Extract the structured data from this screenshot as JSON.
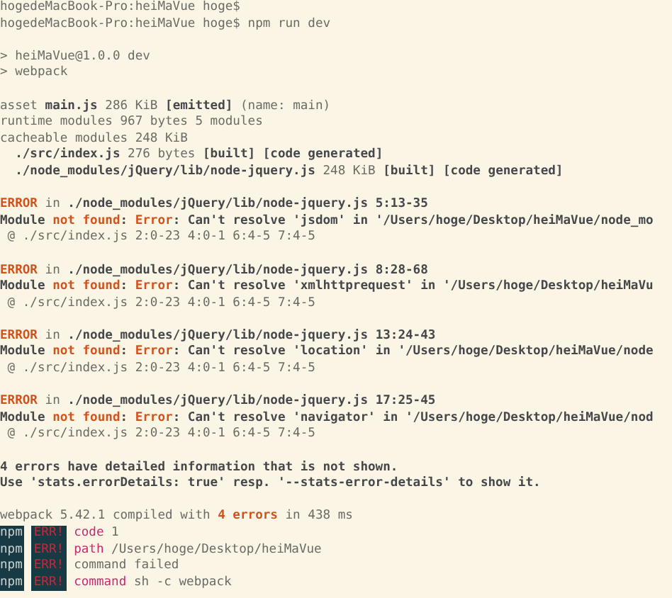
{
  "terminal": {
    "lines": [
      {
        "kind": "text",
        "segments": [
          {
            "text": "hogedeMacBook-Pro:heiMaVue hoge$",
            "kind": "plain"
          }
        ]
      },
      {
        "kind": "text",
        "segments": [
          {
            "text": "hogedeMacBook-Pro:heiMaVue hoge$ npm run dev",
            "kind": "plain"
          }
        ]
      },
      {
        "kind": "blank"
      },
      {
        "kind": "text",
        "segments": [
          {
            "text": "> heiMaVue@1.0.0 dev",
            "kind": "plain"
          }
        ]
      },
      {
        "kind": "text",
        "segments": [
          {
            "text": "> webpack",
            "kind": "plain"
          }
        ]
      },
      {
        "kind": "blank"
      },
      {
        "kind": "text",
        "segments": [
          {
            "text": "asset ",
            "kind": "plain"
          },
          {
            "text": "main.js",
            "kind": "bold"
          },
          {
            "text": " 286 KiB ",
            "kind": "plain"
          },
          {
            "text": "[emitted]",
            "kind": "bold"
          },
          {
            "text": " (name: main)",
            "kind": "plain"
          }
        ]
      },
      {
        "kind": "text",
        "segments": [
          {
            "text": "runtime modules 967 bytes 5 modules",
            "kind": "plain"
          }
        ]
      },
      {
        "kind": "text",
        "segments": [
          {
            "text": "cacheable modules 248 KiB",
            "kind": "plain"
          }
        ]
      },
      {
        "kind": "text",
        "segments": [
          {
            "text": "  ./src/index.js",
            "kind": "bold"
          },
          {
            "text": " 276 bytes ",
            "kind": "plain"
          },
          {
            "text": "[built] [code generated]",
            "kind": "bold"
          }
        ]
      },
      {
        "kind": "text",
        "segments": [
          {
            "text": "  ./node_modules/jQuery/lib/node-jquery.js",
            "kind": "bold"
          },
          {
            "text": " 248 KiB ",
            "kind": "plain"
          },
          {
            "text": "[built] [code generated]",
            "kind": "bold"
          }
        ]
      },
      {
        "kind": "blank"
      },
      {
        "kind": "text",
        "segments": [
          {
            "text": "ERROR",
            "kind": "error"
          },
          {
            "text": " in ",
            "kind": "plain"
          },
          {
            "text": "./node_modules/jQuery/lib/node-jquery.js 5:13-35",
            "kind": "bold"
          }
        ]
      },
      {
        "kind": "text",
        "segments": [
          {
            "text": "Module ",
            "kind": "bold"
          },
          {
            "text": "not found",
            "kind": "error"
          },
          {
            "text": ": ",
            "kind": "bold"
          },
          {
            "text": "Error",
            "kind": "error"
          },
          {
            "text": ": Can't resolve 'jsdom' in '/Users/hoge/Desktop/heiMaVue/node_mo",
            "kind": "bold"
          }
        ]
      },
      {
        "kind": "text",
        "segments": [
          {
            "text": " @ ./src/index.js 2:0-23 4:0-1 6:4-5 7:4-5",
            "kind": "plain"
          }
        ]
      },
      {
        "kind": "blank"
      },
      {
        "kind": "text",
        "segments": [
          {
            "text": "ERROR",
            "kind": "error"
          },
          {
            "text": " in ",
            "kind": "plain"
          },
          {
            "text": "./node_modules/jQuery/lib/node-jquery.js 8:28-68",
            "kind": "bold"
          }
        ]
      },
      {
        "kind": "text",
        "segments": [
          {
            "text": "Module ",
            "kind": "bold"
          },
          {
            "text": "not found",
            "kind": "error"
          },
          {
            "text": ": ",
            "kind": "bold"
          },
          {
            "text": "Error",
            "kind": "error"
          },
          {
            "text": ": Can't resolve 'xmlhttprequest' in '/Users/hoge/Desktop/heiMaVu",
            "kind": "bold"
          }
        ]
      },
      {
        "kind": "text",
        "segments": [
          {
            "text": " @ ./src/index.js 2:0-23 4:0-1 6:4-5 7:4-5",
            "kind": "plain"
          }
        ]
      },
      {
        "kind": "blank"
      },
      {
        "kind": "text",
        "segments": [
          {
            "text": "ERROR",
            "kind": "error"
          },
          {
            "text": " in ",
            "kind": "plain"
          },
          {
            "text": "./node_modules/jQuery/lib/node-jquery.js 13:24-43",
            "kind": "bold"
          }
        ]
      },
      {
        "kind": "text",
        "segments": [
          {
            "text": "Module ",
            "kind": "bold"
          },
          {
            "text": "not found",
            "kind": "error"
          },
          {
            "text": ": ",
            "kind": "bold"
          },
          {
            "text": "Error",
            "kind": "error"
          },
          {
            "text": ": Can't resolve 'location' in '/Users/hoge/Desktop/heiMaVue/node",
            "kind": "bold"
          }
        ]
      },
      {
        "kind": "text",
        "segments": [
          {
            "text": " @ ./src/index.js 2:0-23 4:0-1 6:4-5 7:4-5",
            "kind": "plain"
          }
        ]
      },
      {
        "kind": "blank"
      },
      {
        "kind": "text",
        "segments": [
          {
            "text": "ERROR",
            "kind": "error"
          },
          {
            "text": " in ",
            "kind": "plain"
          },
          {
            "text": "./node_modules/jQuery/lib/node-jquery.js 17:25-45",
            "kind": "bold"
          }
        ]
      },
      {
        "kind": "text",
        "segments": [
          {
            "text": "Module ",
            "kind": "bold"
          },
          {
            "text": "not found",
            "kind": "error"
          },
          {
            "text": ": ",
            "kind": "bold"
          },
          {
            "text": "Error",
            "kind": "error"
          },
          {
            "text": ": Can't resolve 'navigator' in '/Users/hoge/Desktop/heiMaVue/nod",
            "kind": "bold"
          }
        ]
      },
      {
        "kind": "text",
        "segments": [
          {
            "text": " @ ./src/index.js 2:0-23 4:0-1 6:4-5 7:4-5",
            "kind": "plain"
          }
        ]
      },
      {
        "kind": "blank"
      },
      {
        "kind": "text",
        "segments": [
          {
            "text": "4 errors have detailed information that is not shown.",
            "kind": "bold"
          }
        ]
      },
      {
        "kind": "text",
        "segments": [
          {
            "text": "Use 'stats.errorDetails: true' resp. '--stats-error-details' to show it.",
            "kind": "bold"
          }
        ]
      },
      {
        "kind": "blank"
      },
      {
        "kind": "text",
        "segments": [
          {
            "text": "webpack 5.42.1 compiled with ",
            "kind": "plain"
          },
          {
            "text": "4 errors",
            "kind": "error"
          },
          {
            "text": " in 438 ms",
            "kind": "plain"
          }
        ]
      },
      {
        "kind": "npm",
        "prefix": "npm",
        "tag": "ERR!",
        "segments": [
          {
            "text": "code",
            "kind": "magenta"
          },
          {
            "text": " 1",
            "kind": "plain"
          }
        ]
      },
      {
        "kind": "npm",
        "prefix": "npm",
        "tag": "ERR!",
        "segments": [
          {
            "text": "path",
            "kind": "magenta"
          },
          {
            "text": " /Users/hoge/Desktop/heiMaVue",
            "kind": "plain"
          }
        ]
      },
      {
        "kind": "npm",
        "prefix": "npm",
        "tag": "ERR!",
        "segments": [
          {
            "text": "command failed",
            "kind": "plain"
          }
        ]
      },
      {
        "kind": "npm",
        "prefix": "npm",
        "tag": "ERR!",
        "segments": [
          {
            "text": "command",
            "kind": "magenta"
          },
          {
            "text": " sh -c webpack",
            "kind": "plain"
          }
        ]
      }
    ]
  }
}
